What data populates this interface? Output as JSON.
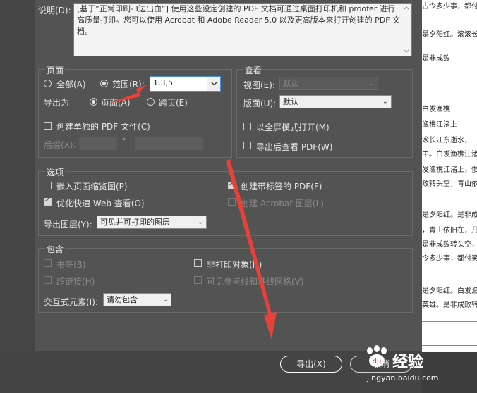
{
  "description": {
    "label": "说明(D):",
    "text": "[基于“正常印刷-3边出血”] 使用这些设定创建的 PDF 文档可通过桌面打印机和 proofer 进行高质量打印。您可以使用 Acrobat 和 Adobe Reader 5.0 以及更高版本来打开创建的 PDF 文档。"
  },
  "pages": {
    "title": "页面",
    "all_label": "全部(A)",
    "range_label": "范围(R):",
    "range_value": "1,3,5",
    "export_as_label": "导出为",
    "pages_option": "页面(A)",
    "spreads_option": "跨页(E)",
    "separate_pdf_label": "创建单独的 PDF 文件(C)",
    "suffix_label": "后缀(X):"
  },
  "view": {
    "title": "查看",
    "view_label": "视图(E):",
    "view_value": "默认",
    "layout_label": "版面(U):",
    "layout_value": "默认",
    "fullscreen_label": "以全屏模式打开(M)",
    "view_after_export_label": "导出后查看 PDF(W)"
  },
  "options": {
    "title": "选项",
    "embed_thumbnails": "嵌入页面缩览图(P)",
    "optimize_web": "优化快速 Web 查看(O)",
    "create_tagged": "创建带标签的 PDF(F)",
    "create_layers": "创建 Acrobat 图层(L)",
    "export_layers_label": "导出图层(Y):",
    "export_layers_value": "可见并可打印的图层"
  },
  "include": {
    "title": "包含",
    "bookmarks": "书签(B)",
    "hyperlinks": "超链接(H)",
    "non_printing": "非打印对象(N)",
    "visible_guides": "可见参考线和基线网格(V)",
    "interactive_label": "交互式元素(I):",
    "interactive_value": "请勿包含"
  },
  "buttons": {
    "export": "导出(X)",
    "cancel": "取消"
  },
  "document_preview": {
    "lines": [
      "古今多少事，都付",
      "",
      "是夕阳红。滚滚长江",
      "",
      "是非成败",
      "",
      "白发渔樵",
      "渔樵江渚上",
      "滚长江东逝水，",
      "中。白发渔樵江渚",
      "发渔樵江渚上，惯",
      "败转头空，青山依",
      "",
      "是夕阳红。是非成败",
      "，青山依旧在，几度",
      "是非成败转头空，",
      "今多少事，都付笑谈中。",
      "",
      "是夕阳红。白发渔樵",
      "英雄。是非成败转头"
    ]
  },
  "watermark": {
    "brand": "经验",
    "url": "jingyan.baidu.com"
  },
  "colors": {
    "dialog_bg": "#535353",
    "annotation_arrow": "#e8413a"
  }
}
